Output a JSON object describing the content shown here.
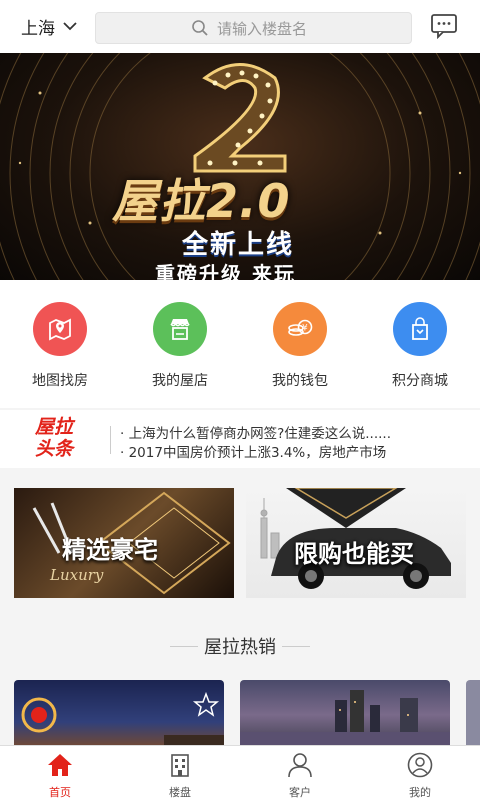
{
  "header": {
    "city": "上海",
    "search_placeholder": "请输入楼盘名"
  },
  "banner": {
    "title": "屋拉2.0",
    "subtitle": "全新上线",
    "tagline": "重磅升级 来玩"
  },
  "nav": [
    {
      "label": "地图找房",
      "icon": "map-icon",
      "color": "#f05454"
    },
    {
      "label": "我的屋店",
      "icon": "store-icon",
      "color": "#5cc05a"
    },
    {
      "label": "我的钱包",
      "icon": "wallet-icon",
      "color": "#f58a3c"
    },
    {
      "label": "积分商城",
      "icon": "shopping-bag-icon",
      "color": "#3d8df0"
    }
  ],
  "news": {
    "logo_line1": "屋拉",
    "logo_line2": "头条",
    "items": [
      "· 上海为什么暂停商办网签?住建委这么说......",
      "· 2017中国房价预计上涨3.4%，房地产市场"
    ]
  },
  "promos": [
    {
      "label": "精选豪宅",
      "script": "Luxury"
    },
    {
      "label": "限购也能买"
    }
  ],
  "section": {
    "title": "屋拉热销"
  },
  "tabbar": [
    {
      "label": "首页",
      "icon": "home-icon",
      "active": true
    },
    {
      "label": "楼盘",
      "icon": "building-icon",
      "active": false
    },
    {
      "label": "客户",
      "icon": "person-icon",
      "active": false
    },
    {
      "label": "我的",
      "icon": "user-circle-icon",
      "active": false
    }
  ],
  "colors": {
    "accent": "#e2231a"
  }
}
